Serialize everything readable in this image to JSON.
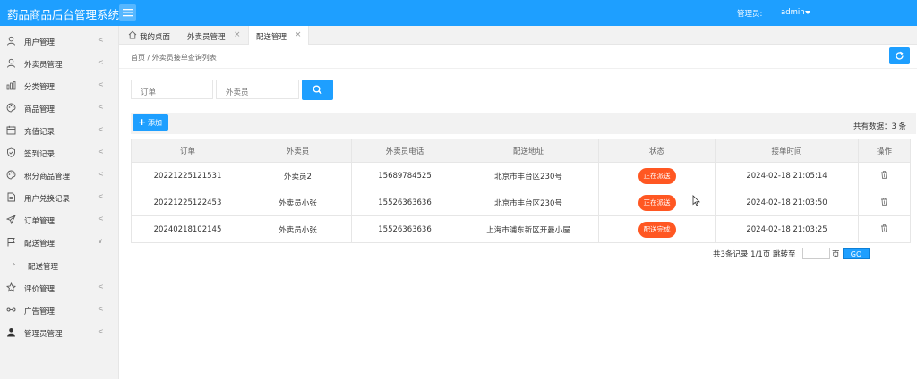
{
  "app": {
    "title": "药品商品后台管理系统",
    "admin_label": "管理员:",
    "admin_name": "admin"
  },
  "sidebar": {
    "items": [
      {
        "label": "用户管理",
        "icon": "user-icon",
        "chevron": "<"
      },
      {
        "label": "外卖员管理",
        "icon": "user-icon",
        "chevron": "<"
      },
      {
        "label": "分类管理",
        "icon": "chart-icon",
        "chevron": "<"
      },
      {
        "label": "商品管理",
        "icon": "palette-icon",
        "chevron": "<"
      },
      {
        "label": "充值记录",
        "icon": "calendar-icon",
        "chevron": "<"
      },
      {
        "label": "签到记录",
        "icon": "shield-icon",
        "chevron": "<"
      },
      {
        "label": "积分商品管理",
        "icon": "palette-icon",
        "chevron": "<"
      },
      {
        "label": "用户兑换记录",
        "icon": "document-icon",
        "chevron": "<"
      },
      {
        "label": "订单管理",
        "icon": "send-icon",
        "chevron": "<"
      },
      {
        "label": "配送管理",
        "icon": "flag-icon",
        "chevron": "∨"
      },
      {
        "label": "评价管理",
        "icon": "star-icon",
        "chevron": "<"
      },
      {
        "label": "广告管理",
        "icon": "link-icon",
        "chevron": "<"
      },
      {
        "label": "管理员管理",
        "icon": "person-icon",
        "chevron": "<"
      }
    ],
    "sub_item": {
      "bullet": "›",
      "label": "配送管理"
    }
  },
  "tabs": [
    {
      "label": "我的桌面",
      "icon": "home-icon"
    },
    {
      "label": "外卖员管理",
      "close": "×"
    },
    {
      "label": "配送管理",
      "close": "×"
    }
  ],
  "breadcrumb": "首页  /  外卖员接单查询列表",
  "search": {
    "order_placeholder": "订单",
    "courier_placeholder": "外卖员"
  },
  "toolbar": {
    "add_label": "添加",
    "total_text": "共有数据：3 条"
  },
  "table": {
    "headers": [
      "订单",
      "外卖员",
      "外卖员电话",
      "配送地址",
      "状态",
      "接单时间",
      "操作"
    ],
    "rows": [
      {
        "order": "20221225121531",
        "courier": "外卖员2",
        "phone": "15689784525",
        "address": "北京市丰台区230号",
        "status": "正在派送",
        "time": "2024-02-18 21:05:14"
      },
      {
        "order": "20221225122453",
        "courier": "外卖员小张",
        "phone": "15526363636",
        "address": "北京市丰台区230号",
        "status": "正在派送",
        "time": "2024-02-18 21:03:50"
      },
      {
        "order": "20240218102145",
        "courier": "外卖员小张",
        "phone": "15526363636",
        "address": "上海市浦东新区开曼小屋",
        "status": "配送完成",
        "time": "2024-02-18 21:03:25"
      }
    ]
  },
  "pager": {
    "summary": "共3条记录  1/1页  跳转至",
    "suffix": "页",
    "go": "GO"
  },
  "colors": {
    "primary": "#1E9FFF",
    "status": "#FF5722"
  }
}
